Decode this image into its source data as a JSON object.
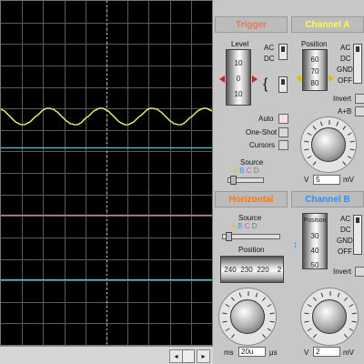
{
  "colors": {
    "trace": "#ffff66",
    "grid": "#5a5a5a",
    "line_cyan": "#4fd0d0",
    "line_red": "#d08080",
    "trigger_title": "#e07a5a",
    "channel_a_title": "#ffff33",
    "horizontal_title": "#ff7700",
    "channel_b_title": "#2f8fff"
  },
  "trigger": {
    "title": "Trigger",
    "level_label": "Level",
    "level_scale": [
      "10",
      "0",
      "10"
    ],
    "ac_label": "AC",
    "dc_label": "DC",
    "auto_label": "Auto",
    "oneshot_label": "One-Shot",
    "cursors_label": "Cursors",
    "source_label": "Source",
    "sources": [
      "A",
      "B",
      "C",
      "D"
    ]
  },
  "channel_a": {
    "title": "Channel A",
    "position_label": "Position",
    "position_scale": [
      "60",
      "70",
      "80"
    ],
    "ac_label": "AC",
    "dc_label": "DC",
    "gnd_label": "GND",
    "off_label": "OFF",
    "invert_label": "Invert",
    "aplusb_label": "A+B",
    "v_label": "V",
    "value": "5",
    "unit": "mV"
  },
  "horizontal": {
    "title": "Horizontal",
    "source_label": "Source",
    "sources": [
      "A",
      "B",
      "C",
      "D"
    ],
    "position_label": "Position",
    "position_scale": [
      "240",
      "230",
      "220",
      "2"
    ],
    "ms_label": "ms",
    "value": "20u",
    "unit": "μs"
  },
  "channel_b": {
    "title": "Channel B",
    "position_label": "Position",
    "position_scale": [
      "30",
      "40",
      "50"
    ],
    "ac_label": "AC",
    "dc_label": "DC",
    "gnd_label": "GND",
    "off_label": "OFF",
    "invert_label": "Invert",
    "v_label": "V",
    "value": "2",
    "unit": "mV"
  }
}
